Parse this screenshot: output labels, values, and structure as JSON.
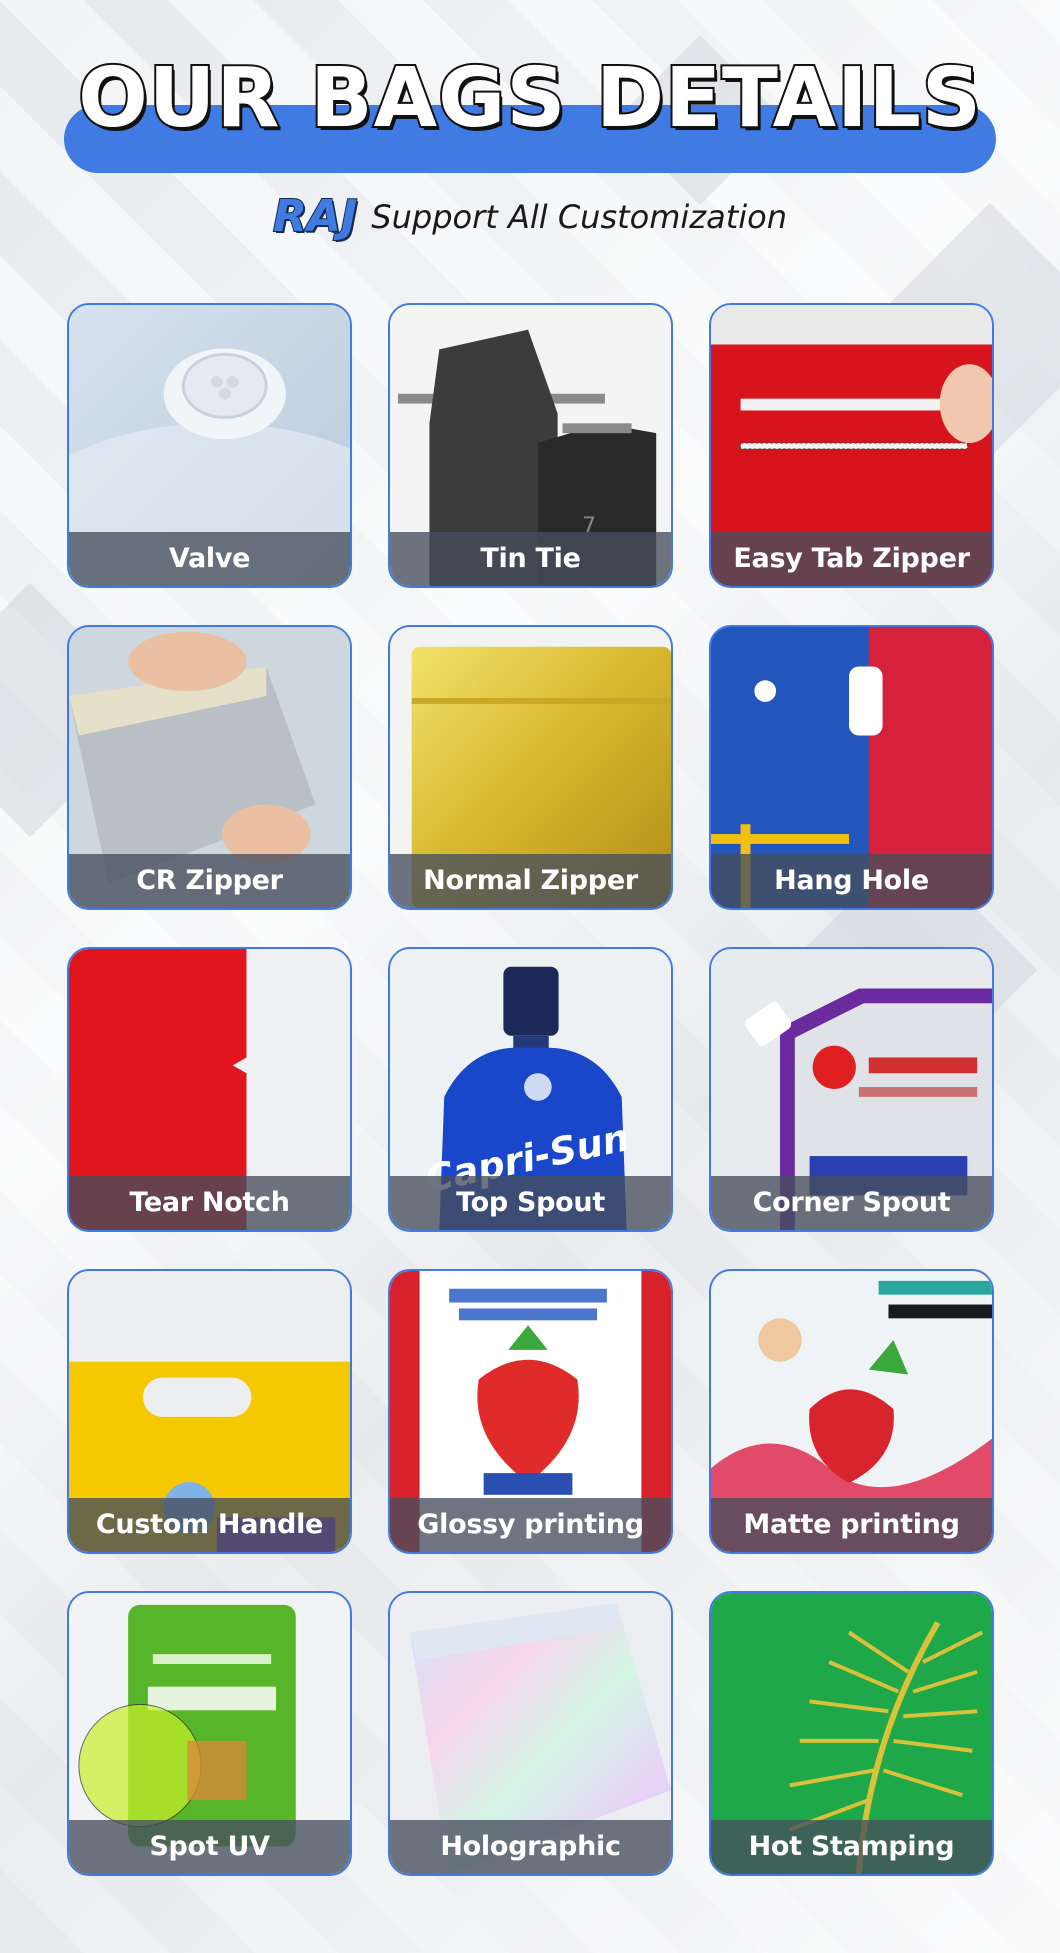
{
  "header": {
    "title": "OUR BAGS DETAILS",
    "brand": "RAJ",
    "tagline": "Support All Customization"
  },
  "colors": {
    "accent": "#3f7be3",
    "caption_bg": "#464e5c"
  },
  "features": [
    {
      "label": "Valve"
    },
    {
      "label": "Tin Tie"
    },
    {
      "label": "Easy Tab Zipper"
    },
    {
      "label": "CR Zipper"
    },
    {
      "label": "Normal Zipper"
    },
    {
      "label": "Hang Hole"
    },
    {
      "label": "Tear Notch"
    },
    {
      "label": "Top Spout"
    },
    {
      "label": "Corner Spout"
    },
    {
      "label": "Custom Handle"
    },
    {
      "label": "Glossy printing"
    },
    {
      "label": "Matte printing"
    },
    {
      "label": "Spot UV"
    },
    {
      "label": "Holographic"
    },
    {
      "label": "Hot Stamping"
    }
  ]
}
